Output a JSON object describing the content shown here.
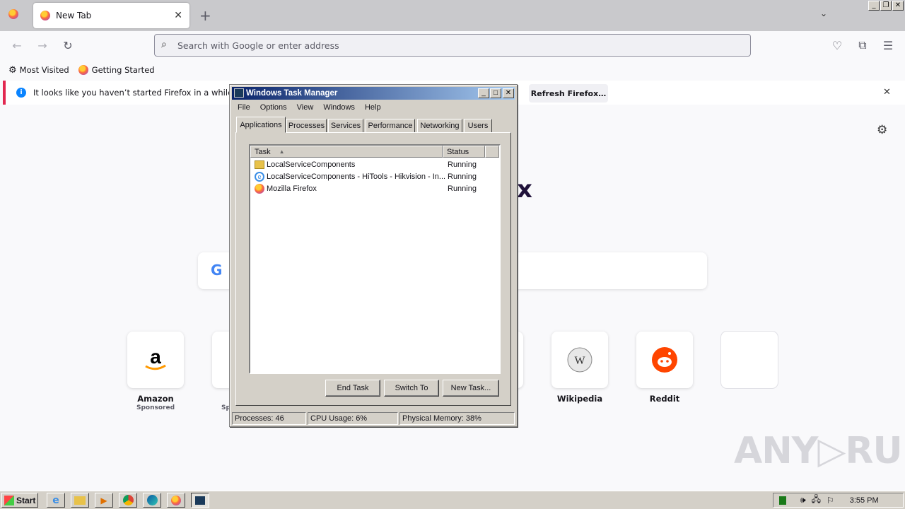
{
  "browser": {
    "tab_title": "New Tab",
    "new_tab_symbol": "+",
    "url_placeholder": "Search with Google or enter address",
    "bookmarks": [
      "Most Visited",
      "Getting Started"
    ],
    "notification": "It looks like you haven’t started Firefox in a while. Do you",
    "refresh_label": "Refresh Firefox…",
    "logo_fragment": "x"
  },
  "shortcuts": [
    {
      "label": "Amazon",
      "sub": "Sponsored"
    },
    {
      "label": "Wikipedia",
      "sub": ""
    },
    {
      "label": "Reddit",
      "sub": ""
    }
  ],
  "partial_sub": "Sp",
  "task_manager": {
    "title": "Windows Task Manager",
    "menu": [
      "File",
      "Options",
      "View",
      "Windows",
      "Help"
    ],
    "tabs": [
      "Applications",
      "Processes",
      "Services",
      "Performance",
      "Networking",
      "Users"
    ],
    "columns": [
      "Task",
      "Status"
    ],
    "rows": [
      {
        "task": "LocalServiceComponents",
        "status": "Running",
        "icon": "folder-icon"
      },
      {
        "task": "LocalServiceComponents - HiTools - Hikvision - In...",
        "status": "Running",
        "icon": "ie-icon"
      },
      {
        "task": "Mozilla Firefox",
        "status": "Running",
        "icon": "firefox-icon"
      }
    ],
    "buttons": [
      "End Task",
      "Switch To",
      "New Task..."
    ],
    "status": {
      "processes": "Processes: 46",
      "cpu": "CPU Usage: 6%",
      "memory": "Physical Memory: 38%"
    }
  },
  "taskbar": {
    "start": "Start",
    "clock": "3:55 PM"
  },
  "watermark": "ANY▷RUN"
}
